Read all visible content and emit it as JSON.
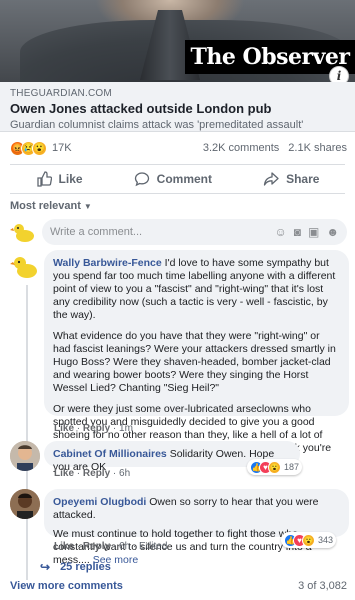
{
  "preview": {
    "brand": "The Observer",
    "domain": "THEGUARDIAN.COM",
    "headline": "Owen Jones attacked outside London pub",
    "subhead": "Guardian columnist claims attack was 'premeditated assault'"
  },
  "stats": {
    "reactions": "17K",
    "comments": "3.2K comments",
    "shares": "2.1K shares"
  },
  "actions": {
    "like": "Like",
    "comment": "Comment",
    "share": "Share"
  },
  "sort": {
    "label": "Most relevant"
  },
  "composer": {
    "placeholder": "Write a comment..."
  },
  "comments": [
    {
      "name": "Wally Barbwire-Fence",
      "p1": " I'd love to have some sympathy but you spend far too much time labelling anyone with a different point of view to you a \"fascist\" and \"right-wing\" that it's lost any credibility now (such a tactic is very - well - fascistic, by the way).",
      "p2": "What evidence do you have that they were \"right-wing\" or had fascist leanings? Were your attackers dressed smartly in Hugo Boss? Were they shaven-headed, bomber jacket-clad and wearing bower boots? Were they singing the Horst Wessel Lied? Chanting \"Sieg Heil?\"",
      "p3": "Or were they just some over-lubricated arseclowns who spotted you and misguidedly decided to give you a good shoeing for no other reason than they, like a hell of a lot of ordinary hard-working definitely non-fascist folk, think you're an utter cunt?",
      "like": "Like",
      "reply": "Reply",
      "time": "1m"
    },
    {
      "name": "Cabinet Of Millionaires",
      "text": " Solidarity Owen. Hope you are OK",
      "like": "Like",
      "reply": "Reply",
      "time": "6h",
      "reactions": "187"
    },
    {
      "name": "Opeyemi Olugbodi",
      "p1": " Owen so sorry to hear that you were attacked.",
      "p2": "We must continue to hold together to fight those who constantly want to silence us and turn the country into a mess.... ",
      "see_more": "See more",
      "like": "Like",
      "reply": "Reply",
      "time": "6h",
      "edited": "Edited",
      "reactions": "343"
    }
  ],
  "replies": "25 replies",
  "footer": {
    "view_more": "View more comments",
    "count": "3 of 3,082"
  },
  "colors": {
    "link": "#385898",
    "fb_blue": "#1877f2",
    "bubble": "#f0f2f5"
  }
}
